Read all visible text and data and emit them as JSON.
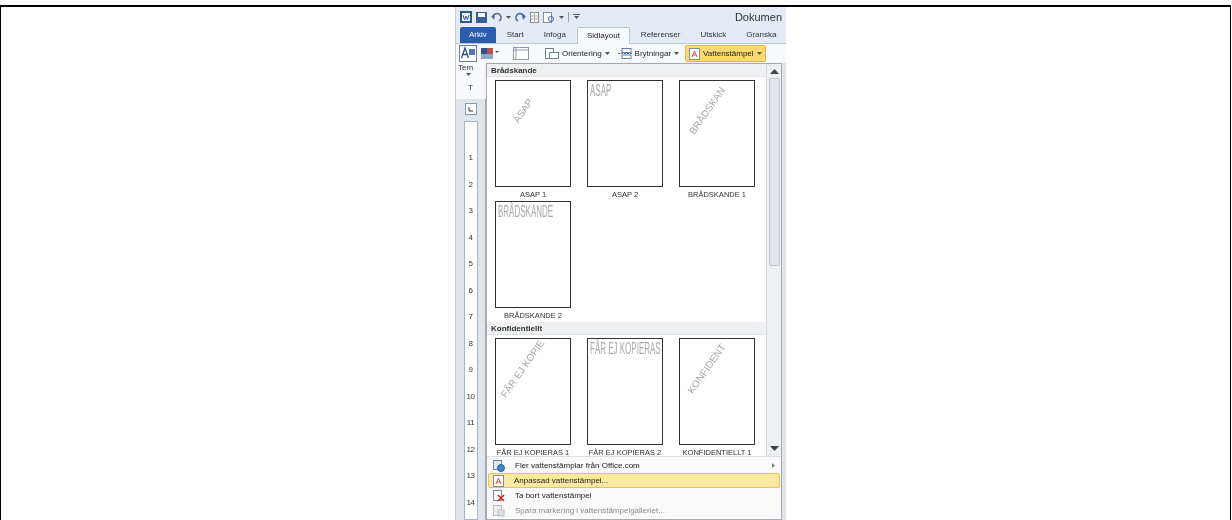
{
  "title_bar": {
    "title": "Dokumen"
  },
  "tabs": [
    {
      "label": "Arkiv",
      "kind": "file",
      "selected": false
    },
    {
      "label": "Start",
      "kind": "tab",
      "selected": false
    },
    {
      "label": "Infoga",
      "kind": "tab",
      "selected": false
    },
    {
      "label": "Sidlayout",
      "kind": "tab",
      "selected": true
    },
    {
      "label": "Referenser",
      "kind": "tab",
      "selected": false
    },
    {
      "label": "Utskick",
      "kind": "tab",
      "selected": false
    },
    {
      "label": "Granska",
      "kind": "tab",
      "selected": false
    }
  ],
  "ribbon": {
    "buttons": [
      {
        "label": "Orientering",
        "active": false
      },
      {
        "label": "Brytningar",
        "active": false
      },
      {
        "label": "Vattenstämpel",
        "active": true
      }
    ],
    "side_labels": [
      "Tem",
      "T"
    ]
  },
  "ruler": [
    "1",
    "2",
    "3",
    "4",
    "5",
    "6",
    "7",
    "8",
    "9",
    "10",
    "11",
    "12",
    "13",
    "14"
  ],
  "gallery": {
    "sections": [
      {
        "title": "Brådskande",
        "items": [
          {
            "label": "ASAP 1",
            "watermark": "ASAP",
            "kind": "diagonal"
          },
          {
            "label": "ASAP 2",
            "watermark": "ASAP",
            "kind": "horizontal"
          },
          {
            "label": "BRÅDSKANDE 1",
            "watermark": "BRÅDSKAN",
            "kind": "diagonal"
          },
          {
            "label": "BRÅDSKANDE 2",
            "watermark": "BRÅDSKANDE",
            "kind": "horizontal"
          }
        ]
      },
      {
        "title": "Konfidentiellt",
        "items": [
          {
            "label": "FÅR EJ KOPIERAS 1",
            "watermark": "FÅR EJ KOPIE",
            "kind": "diagonal"
          },
          {
            "label": "FÅR EJ KOPIERAS 2",
            "watermark": "FÅR EJ KOPIERAS",
            "kind": "horizontal"
          },
          {
            "label": "KONFIDENTIELLT 1",
            "watermark": "KONFIDENT",
            "kind": "diagonal"
          }
        ]
      }
    ]
  },
  "menu": [
    {
      "label": "Fler vattenstämplar från Office.com",
      "submenu": true,
      "highlighted": false,
      "disabled": false
    },
    {
      "label": "Anpassad vattenstämpel...",
      "submenu": false,
      "highlighted": true,
      "disabled": false
    },
    {
      "label": "Ta bort vattenstämpel",
      "submenu": false,
      "highlighted": false,
      "disabled": false
    },
    {
      "label": "Spara markering i vattenstämpelgalleriet...",
      "submenu": false,
      "highlighted": false,
      "disabled": true
    }
  ]
}
